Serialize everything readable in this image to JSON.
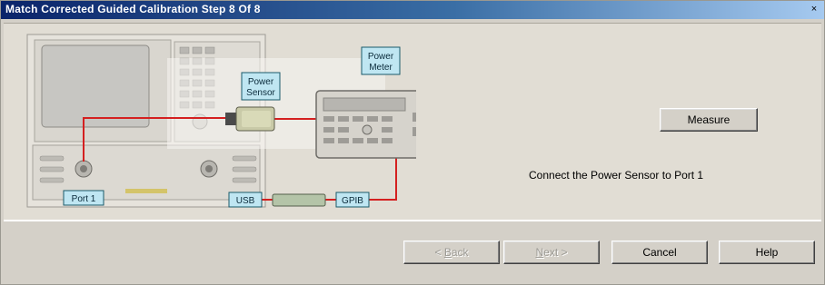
{
  "window": {
    "title": "Match Corrected Guided Calibration Step 8 Of 8",
    "close_glyph": "×"
  },
  "diagram": {
    "power_sensor_label_line1": "Power",
    "power_sensor_label_line2": "Sensor",
    "power_meter_label_line1": "Power",
    "power_meter_label_line2": "Meter",
    "port_label": "Port 1",
    "usb_label": "USB",
    "gpib_label": "GPIB",
    "colors": {
      "cable": "#d42020",
      "label_bg": "#bfe6f2",
      "label_border": "#1a5a6a"
    }
  },
  "main": {
    "measure_label": "Measure",
    "instruction": "Connect the Power Sensor to Port 1"
  },
  "footer": {
    "back_prefix": "< ",
    "back_mnemonic": "B",
    "back_rest": "ack",
    "next_mnemonic": "N",
    "next_rest": "ext >",
    "cancel_label": "Cancel",
    "help_label": "Help"
  }
}
